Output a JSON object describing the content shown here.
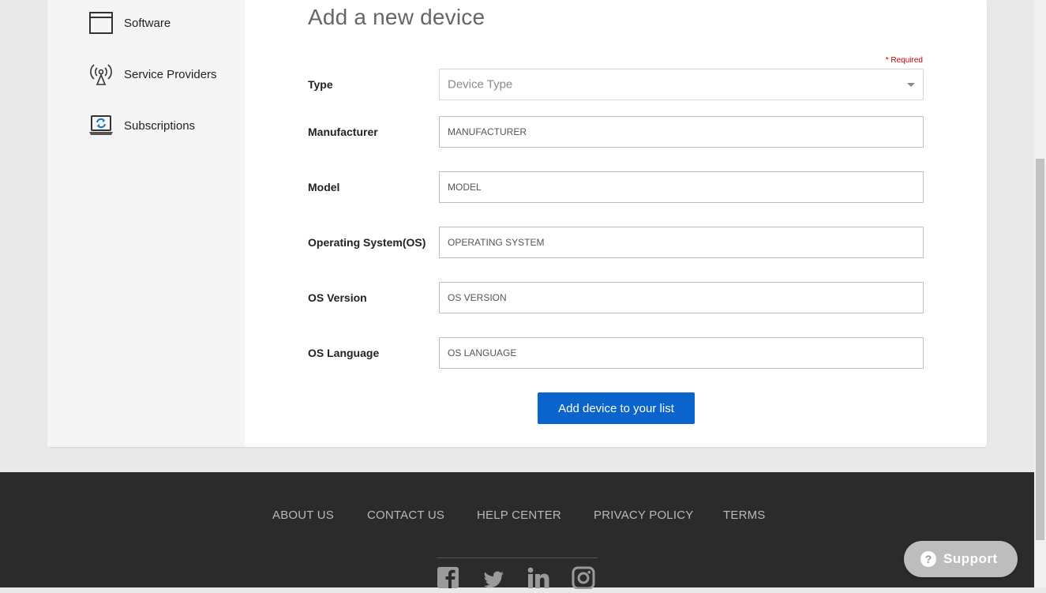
{
  "sidebar": {
    "items": [
      {
        "label": "Software",
        "icon": "window-icon"
      },
      {
        "label": "Service Providers",
        "icon": "antenna-icon"
      },
      {
        "label": "Subscriptions",
        "icon": "laptop-sync-icon"
      }
    ]
  },
  "form": {
    "title": "Add a new device",
    "required_note": "* Required",
    "type": {
      "label": "Type",
      "placeholder": "Device Type"
    },
    "manufacturer": {
      "label": "Manufacturer",
      "placeholder": "MANUFACTURER"
    },
    "model": {
      "label": "Model",
      "placeholder": "MODEL"
    },
    "os": {
      "label": "Operating System(OS)",
      "placeholder": "OPERATING SYSTEM"
    },
    "os_version": {
      "label": "OS Version",
      "placeholder": "OS VERSION"
    },
    "os_language": {
      "label": "OS Language",
      "placeholder": "OS LANGUAGE"
    },
    "submit_label": "Add device to your list"
  },
  "footer": {
    "links": [
      "ABOUT US",
      "CONTACT US",
      "HELP CENTER",
      "PRIVACY POLICY",
      "TERMS"
    ],
    "social": [
      "facebook-icon",
      "twitter-icon",
      "linkedin-icon",
      "instagram-icon"
    ]
  },
  "support": {
    "label": "Support"
  },
  "colors": {
    "primary_button": "#0b63cc",
    "required": "#cc0000",
    "footer_bg": "#2b2b2b",
    "page_bg": "#e9e9e9"
  }
}
